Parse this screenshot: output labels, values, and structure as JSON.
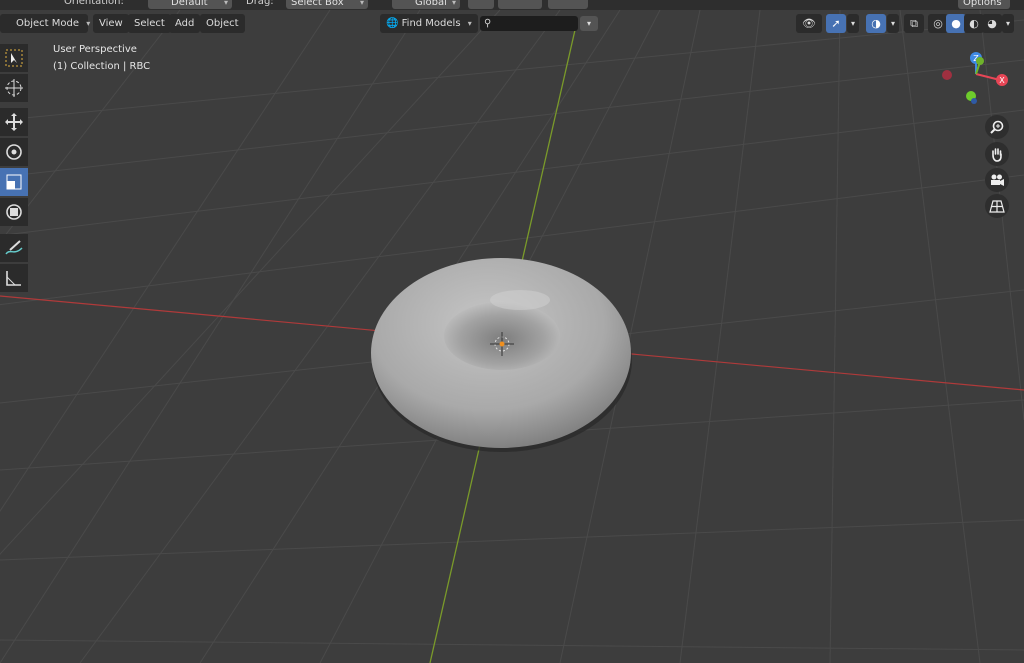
{
  "header_top": {
    "orientation_label": "Orientation:",
    "orientation_value": "Default",
    "drag_label": "Drag:",
    "drag_value": "Select Box",
    "transform_value": "Global",
    "options_label": "Options"
  },
  "header": {
    "mode": "Object Mode",
    "menu": [
      "View",
      "Select",
      "Add",
      "Object"
    ],
    "find_models": "Find Models",
    "search_placeholder": ""
  },
  "overlay": {
    "perspective": "User Perspective",
    "collection": "(1) Collection | RBC"
  },
  "toolbar": {
    "tools": [
      "select-box",
      "cursor",
      "move",
      "rotate",
      "scale",
      "transform",
      "annotate",
      "measure"
    ],
    "active": "scale"
  },
  "gizmo": {
    "axes": [
      "X",
      "Y",
      "Z"
    ],
    "colors": {
      "x": "#e84656",
      "y": "#6fb32b",
      "z": "#3f8ae4"
    }
  },
  "viewport": {
    "object": "torus-rbc",
    "x_axis_color": "#b03a3a",
    "y_axis_color": "#7a9a2a"
  }
}
